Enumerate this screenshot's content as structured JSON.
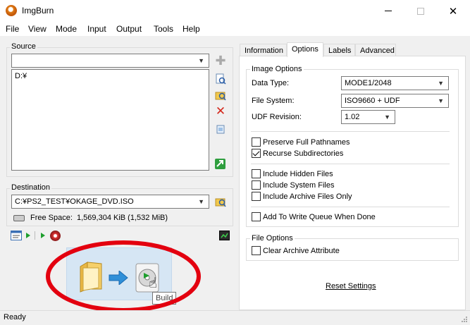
{
  "window": {
    "title": "ImgBurn"
  },
  "menu": [
    "File",
    "View",
    "Mode",
    "Input",
    "Output",
    "Tools",
    "Help"
  ],
  "source": {
    "label": "Source",
    "combo_value": "",
    "items": [
      "D:¥"
    ]
  },
  "destination": {
    "label": "Destination",
    "path": "C:¥PS2_TEST¥OKAGE_DVD.ISO",
    "free_space_label": "Free Space:",
    "free_space_value": "1,569,304 KiB  (1,532 MiB)"
  },
  "build": {
    "tooltip": "Build"
  },
  "tabs": [
    "Information",
    "Options",
    "Labels",
    "Advanced"
  ],
  "active_tab": "Options",
  "image_options": {
    "label": "Image Options",
    "data_type_label": "Data Type:",
    "data_type_value": "MODE1/2048",
    "file_system_label": "File System:",
    "file_system_value": "ISO9660 + UDF",
    "udf_revision_label": "UDF Revision:",
    "udf_revision_value": "1.02",
    "checks": {
      "preserve_full_pathnames": {
        "label": "Preserve Full Pathnames",
        "checked": false
      },
      "recurse_subdirectories": {
        "label": "Recurse Subdirectories",
        "checked": true
      },
      "include_hidden_files": {
        "label": "Include Hidden Files",
        "checked": false
      },
      "include_system_files": {
        "label": "Include System Files",
        "checked": false
      },
      "include_archive_files_only": {
        "label": "Include Archive Files Only",
        "checked": false
      },
      "add_to_write_queue": {
        "label": "Add To Write Queue When Done",
        "checked": false
      }
    }
  },
  "file_options": {
    "label": "File Options",
    "clear_archive_attribute": {
      "label": "Clear Archive Attribute",
      "checked": false
    }
  },
  "reset_settings": "Reset Settings",
  "status_text": "Ready",
  "colors": {
    "annotation_circle": "#e3000f",
    "accent_green": "#1e9e2e",
    "tooltip_border": "#767676"
  }
}
